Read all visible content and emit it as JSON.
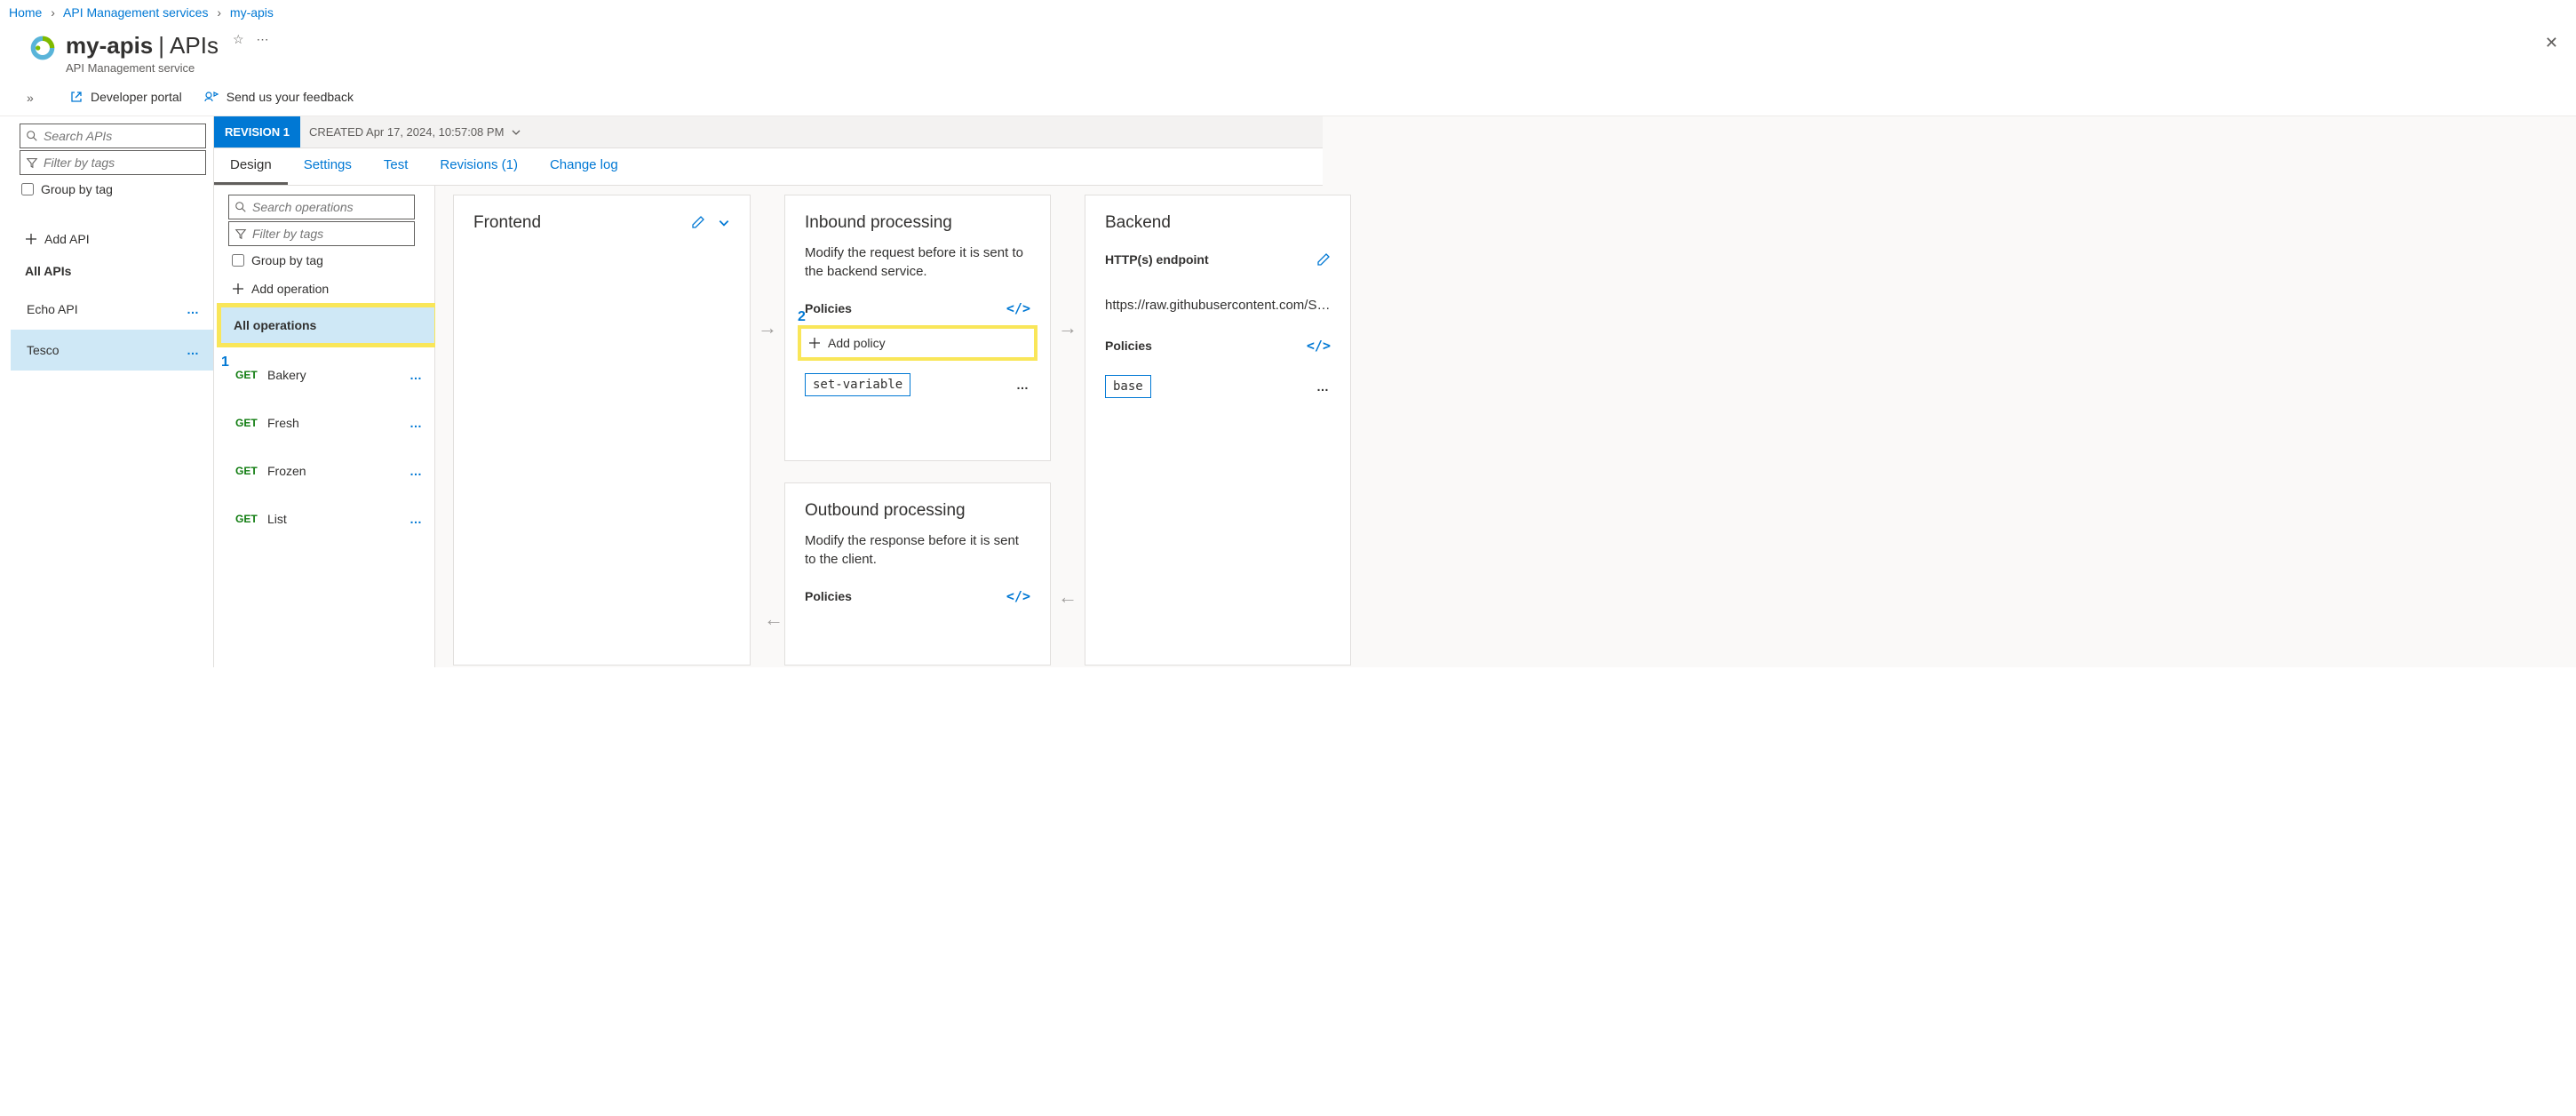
{
  "breadcrumb": [
    "Home",
    "API Management services",
    "my-apis"
  ],
  "header": {
    "title_bold": "my-apis",
    "title_rest": "APIs",
    "subtitle": "API Management service"
  },
  "commands": {
    "developer_portal": "Developer portal",
    "feedback": "Send us your feedback"
  },
  "api_sidebar": {
    "search_placeholder": "Search APIs",
    "filter_placeholder": "Filter by tags",
    "group_by_tag": "Group by tag",
    "add_api": "Add API",
    "all_apis": "All APIs",
    "apis": [
      {
        "name": "Echo API",
        "selected": false
      },
      {
        "name": "Tesco",
        "selected": true
      }
    ]
  },
  "revision": {
    "label": "REVISION 1",
    "created": "CREATED Apr 17, 2024, 10:57:08 PM"
  },
  "tabs": [
    {
      "label": "Design",
      "active": true
    },
    {
      "label": "Settings",
      "active": false
    },
    {
      "label": "Test",
      "active": false
    },
    {
      "label": "Revisions (1)",
      "active": false
    },
    {
      "label": "Change log",
      "active": false
    }
  ],
  "operations": {
    "search_placeholder": "Search operations",
    "filter_placeholder": "Filter by tags",
    "group_by_tag": "Group by tag",
    "add_operation": "Add operation",
    "all_ops": "All operations",
    "items": [
      {
        "method": "GET",
        "name": "Bakery"
      },
      {
        "method": "GET",
        "name": "Fresh"
      },
      {
        "method": "GET",
        "name": "Frozen"
      },
      {
        "method": "GET",
        "name": "List"
      }
    ]
  },
  "callouts": {
    "one": "1",
    "two": "2"
  },
  "frontend": {
    "title": "Frontend"
  },
  "inbound": {
    "title": "Inbound processing",
    "desc": "Modify the request before it is sent to the backend service.",
    "policies_label": "Policies",
    "add_policy": "Add policy",
    "chip": "set-variable"
  },
  "outbound": {
    "title": "Outbound processing",
    "desc": "Modify the response before it is sent to the client.",
    "policies_label": "Policies"
  },
  "backend": {
    "title": "Backend",
    "endpoint_label": "HTTP(s) endpoint",
    "url": "https://raw.githubusercontent.com/Sirwan…",
    "policies_label": "Policies",
    "chip": "base"
  }
}
